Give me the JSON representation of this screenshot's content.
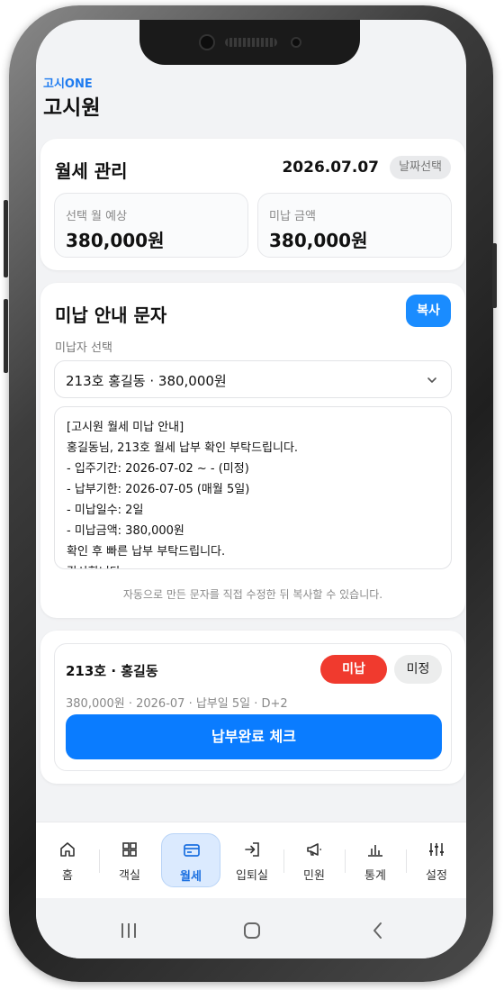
{
  "app": {
    "brand": "고시ONE",
    "page_title": "고시원"
  },
  "rent": {
    "title": "월세 관리",
    "date": "2026.07.07",
    "date_button": "날짜선택",
    "expected_label": "선택 월 예상",
    "expected_value": "380,000원",
    "unpaid_label": "미납 금액",
    "unpaid_value": "380,000원"
  },
  "notice": {
    "title": "미납 안내 문자",
    "copy_button": "복사",
    "select_label": "미납자 선택",
    "selected_option": "213호 홍길동 · 380,000원",
    "message_lines": [
      "[고시원 월세 미납 안내]",
      "홍길동님, 213호 월세 납부 확인 부탁드립니다.",
      "- 입주기간: 2026-07-02 ~ - (미정)",
      "- 납부기한: 2026-07-05 (매월 5일)",
      "- 미납일수: 2일",
      "- 미납금액: 380,000원",
      "확인 후 빠른 납부 부탁드립니다.",
      "감사합니다."
    ],
    "hint": "자동으로 만든 문자를 직접 수정한 뒤 복사할 수 있습니다."
  },
  "tenant": {
    "room": "213호 · 홍길동",
    "status_unpaid": "미납",
    "status_pending": "미정",
    "meta": "380,000원 · 2026-07 · 납부일 5일 · D+2",
    "pay_button": "납부완료 체크"
  },
  "tabs": [
    {
      "label": "홈",
      "icon": "home-icon"
    },
    {
      "label": "객실",
      "icon": "grid-icon"
    },
    {
      "label": "월세",
      "icon": "card-icon",
      "active": true
    },
    {
      "label": "입퇴실",
      "icon": "enter-icon"
    },
    {
      "label": "민원",
      "icon": "megaphone-icon"
    },
    {
      "label": "통계",
      "icon": "chart-icon"
    },
    {
      "label": "설정",
      "icon": "sliders-icon"
    }
  ],
  "colors": {
    "accent": "#0a7cff",
    "danger": "#f03a2e",
    "active_tab_bg": "#dbeafe"
  }
}
